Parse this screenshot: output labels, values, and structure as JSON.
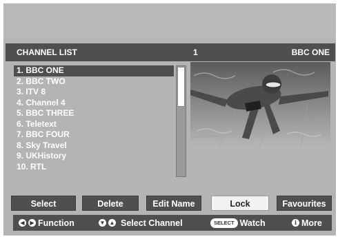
{
  "header": {
    "title": "CHANNEL LIST",
    "channel_number": "1",
    "channel_name": "BBC ONE"
  },
  "channels": [
    "1. BBC ONE",
    "2. BBC TWO",
    "3. ITV 8",
    "4. Channel 4",
    "5. BBC THREE",
    "6. Teletext",
    "7. BBC FOUR",
    "8. Sky Travel",
    "9. UKHistory",
    "10. RTL"
  ],
  "selected_index": 0,
  "buttons": {
    "select": "Select",
    "delete": "Delete",
    "edit_name": "Edit Name",
    "lock": "Lock",
    "favourites": "Favourites"
  },
  "help": {
    "function_label": "Function",
    "select_channel_label": "Select Channel",
    "select_key": "SELECT",
    "watch_label": "Watch",
    "info_key": "i",
    "more_label": "More"
  },
  "colors": {
    "panel": "#b4b4b4",
    "bar": "#4f4f4f",
    "text": "#ffffff",
    "active_button": "#f2f2f2"
  },
  "icons": {
    "left_right": "left-right-arrows-icon",
    "up_down": "up-down-arrows-icon",
    "select": "select-key-icon",
    "info": "info-icon"
  }
}
